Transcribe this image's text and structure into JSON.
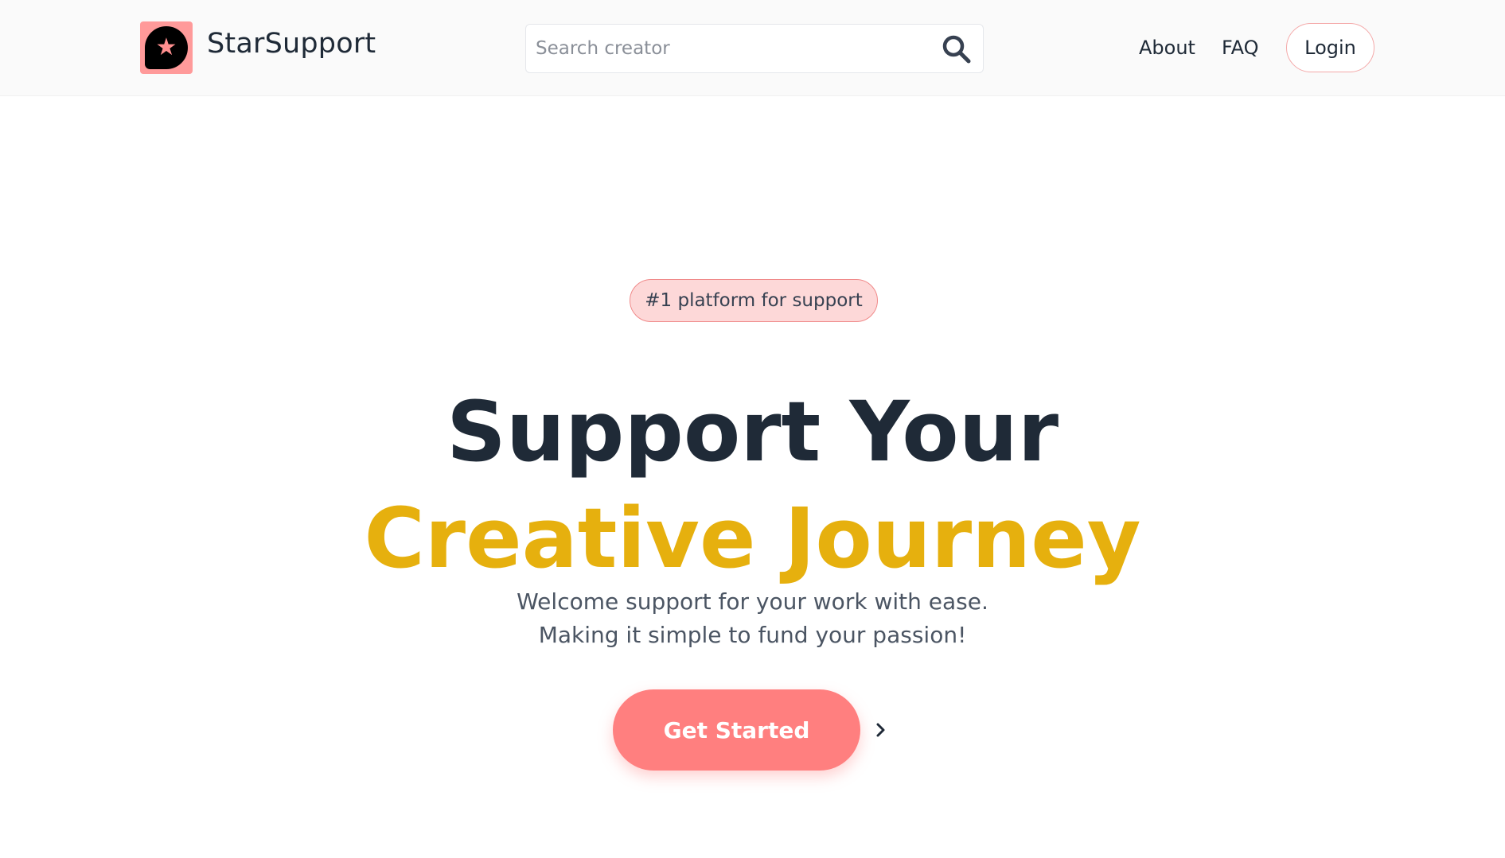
{
  "brand": {
    "name": "StarSupport",
    "logo_icon": "star-badge-icon",
    "logo_glyph": "★",
    "logo_bg": "#ff9a9a"
  },
  "search": {
    "placeholder": "Search creator",
    "value": "",
    "icon": "search-icon"
  },
  "nav": {
    "about": "About",
    "faq": "FAQ",
    "login": "Login"
  },
  "hero": {
    "badge": "#1 platform for support",
    "headline_line1": "Support Your",
    "headline_line2": "Creative Journey",
    "subtitle_line1": "Welcome support for your work with ease.",
    "subtitle_line2": "Making it simple to fund your passion!",
    "cta_label": "Get Started",
    "cta_arrow_icon": "chevron-right-icon"
  },
  "colors": {
    "accent": "#ff7f7f",
    "highlight": "#e6b00e",
    "text_dark": "#1f2a37",
    "badge_bg": "#fdd8d8"
  }
}
